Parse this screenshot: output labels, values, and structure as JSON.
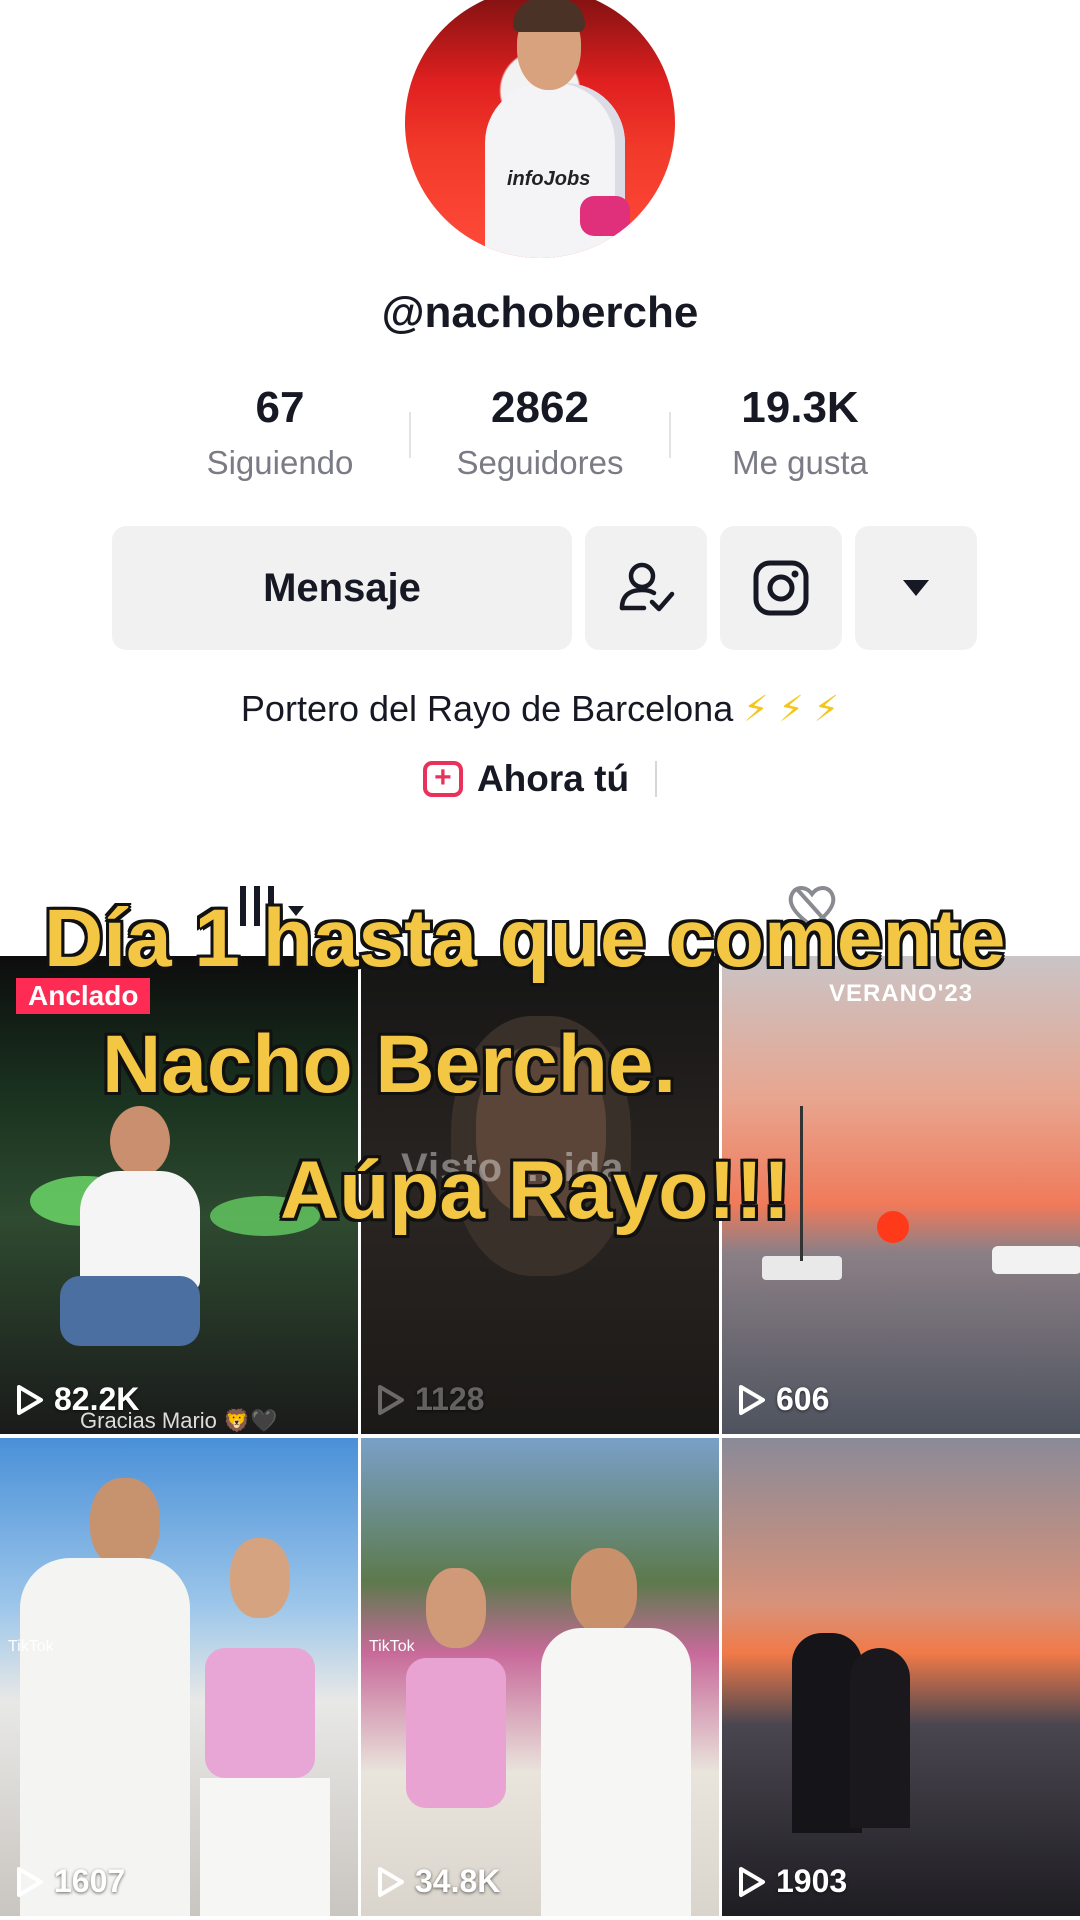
{
  "profile": {
    "username": "@nachoberche",
    "avatar_text": "infoJobs"
  },
  "stats": [
    {
      "value": "67",
      "label": "Siguiendo"
    },
    {
      "value": "2862",
      "label": "Seguidores"
    },
    {
      "value": "19.3K",
      "label": "Me gusta"
    }
  ],
  "actions": {
    "message_label": "Mensaje",
    "friends_icon": "person-check-icon",
    "instagram_icon": "instagram-icon",
    "more_icon": "triangle-down-icon"
  },
  "bio": {
    "text": "Portero del Rayo de Barcelona",
    "emoji": "⚡ ⚡ ⚡"
  },
  "link": {
    "label": "Ahora tú",
    "icon": "plus-square-icon"
  },
  "tabs": {
    "videos_icon": "grid-icon",
    "liked_icon": "heart-hidden-icon"
  },
  "videos": [
    {
      "views": "82.2K",
      "pinned_label": "Anclado",
      "caption": "Gracias Mario 🦁🖤"
    },
    {
      "views": "1128",
      "text": "Visto ... ida"
    },
    {
      "views": "606",
      "label": "VERANO'23"
    },
    {
      "views": "1607",
      "watermark": "TikTok"
    },
    {
      "views": "34.8K",
      "watermark": "TikTok"
    },
    {
      "views": "1903"
    }
  ],
  "overlay": {
    "line1": "Día 1 hasta que comente",
    "line2": "Nacho Berche.",
    "line3": "Aúpa Rayo!!!"
  },
  "colors": {
    "accent": "#fe2c55",
    "overlay_text": "#f3c743",
    "button_bg": "#f1f1f2",
    "muted_text": "#7a7b85"
  }
}
